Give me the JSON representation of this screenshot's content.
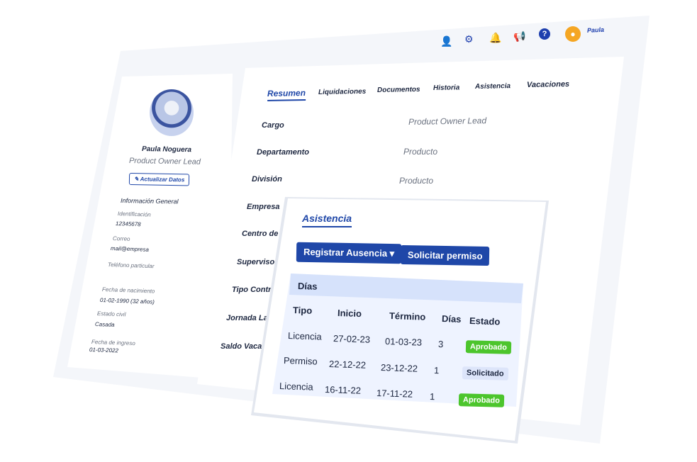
{
  "topbar": {
    "user_name": "Paula",
    "icons": [
      "user-search-icon",
      "gear-icon",
      "bell-icon",
      "megaphone-icon",
      "help-icon",
      "avatar-icon"
    ]
  },
  "profile": {
    "name": "Paula Noguera",
    "role": "Product Owner Lead",
    "update_button": "Actualizar Datos",
    "section_title": "Información General",
    "fields": [
      {
        "label": "Identificación",
        "value": "12345678"
      },
      {
        "label": "Correo",
        "value": "mail@empresa"
      },
      {
        "label": "Teléfono particular",
        "value": ""
      },
      {
        "label": "Fecha de nacimiento",
        "value": "01-02-1990 (32 años)"
      },
      {
        "label": "Estado civil",
        "value": "Casada"
      },
      {
        "label": "Fecha de ingreso",
        "value": "01-03-2022"
      }
    ]
  },
  "tabs": [
    "Resumen",
    "Liquidaciones",
    "Documentos",
    "Historia",
    "Asistencia",
    "Vacaciones"
  ],
  "summary": [
    {
      "label": "Cargo",
      "value": "Product Owner Lead"
    },
    {
      "label": "Departamento",
      "value": "Producto"
    },
    {
      "label": "División",
      "value": "Producto"
    },
    {
      "label": "Empresa",
      "value": ""
    },
    {
      "label": "Centro de C",
      "value": ""
    },
    {
      "label": "Supervisor",
      "value": ""
    },
    {
      "label": "Tipo Contra",
      "value": ""
    },
    {
      "label": "Jornada Lal",
      "value": ""
    },
    {
      "label": "Saldo Vaca",
      "value": ""
    }
  ],
  "attendance": {
    "title": "Asistencia",
    "register_button": "Registrar Ausencia",
    "request_button": "Solicitar permiso",
    "table_title": "Días",
    "columns": [
      "Tipo",
      "Inicio",
      "Término",
      "Días",
      "Estado"
    ],
    "rows": [
      {
        "tipo": "Licencia",
        "inicio": "27-02-23",
        "termino": "01-03-23",
        "dias": "3",
        "estado": "Aprobado"
      },
      {
        "tipo": "Permiso",
        "inicio": "22-12-22",
        "termino": "23-12-22",
        "dias": "1",
        "estado": "Solicitado"
      },
      {
        "tipo": "Licencia",
        "inicio": "16-11-22",
        "termino": "17-11-22",
        "dias": "1",
        "estado": "Aprobado"
      }
    ]
  },
  "colors": {
    "primary": "#1f47a8",
    "approved": "#4cc52c",
    "requested": "#dde5fa",
    "avatar": "#f5a623"
  }
}
